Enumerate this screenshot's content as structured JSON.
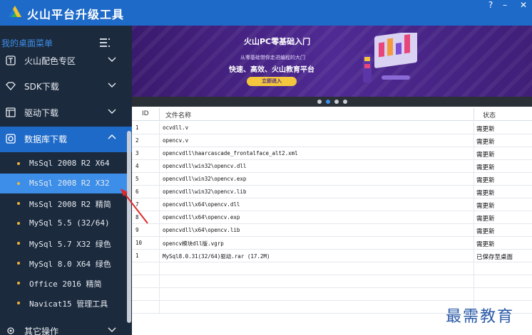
{
  "app": {
    "title": "火山平台升级工具",
    "help": "?",
    "minimize": "–",
    "close": "✕"
  },
  "sidebar": {
    "header": "我的桌面菜单",
    "categories": [
      {
        "label": "火山配色专区",
        "icon": "text-box-icon",
        "expanded": false
      },
      {
        "label": "SDK下载",
        "icon": "diamond-icon",
        "expanded": false
      },
      {
        "label": "驱动下载",
        "icon": "window-icon",
        "expanded": false
      },
      {
        "label": "数据库下载",
        "icon": "database-icon",
        "expanded": true
      },
      {
        "label": "其它操作",
        "icon": "gear-icon",
        "expanded": false
      }
    ],
    "subitems": [
      {
        "label": "MsSql 2008 R2 X64"
      },
      {
        "label": "MsSql 2008 R2 X32"
      },
      {
        "label": "MsSql 2008 R2 精简"
      },
      {
        "label": "MySql 5.5 (32/64)"
      },
      {
        "label": "MySql 5.7 X32 绿色"
      },
      {
        "label": "MySql 8.0 X64 绿色"
      },
      {
        "label": "Office 2016 精简"
      },
      {
        "label": "Navicat15 管理工具"
      }
    ],
    "selected_index": 1,
    "accent": "#1e6ac8"
  },
  "banner": {
    "title": "火山PC零基础入门",
    "subtitle": "从零基础带你走进编程的大门",
    "slogan": "快速、高效、火山教育平台",
    "button": "立即进入",
    "slides": 4,
    "active_slide": 1
  },
  "table": {
    "headers": {
      "id": "ID",
      "name": "文件名称",
      "status": "状态"
    },
    "rows": [
      {
        "id": "1",
        "name": "ocvdll.v",
        "status": "需更新"
      },
      {
        "id": "2",
        "name": "opencv.v",
        "status": "需更新"
      },
      {
        "id": "3",
        "name": "opencvdll\\haarcascade_frontalface_alt2.xml",
        "status": "需更新"
      },
      {
        "id": "4",
        "name": "opencvdll\\win32\\opencv.dll",
        "status": "需更新"
      },
      {
        "id": "5",
        "name": "opencvdll\\win32\\opencv.exp",
        "status": "需更新"
      },
      {
        "id": "6",
        "name": "opencvdll\\win32\\opencv.lib",
        "status": "需更新"
      },
      {
        "id": "7",
        "name": "opencvdll\\x64\\opencv.dll",
        "status": "需更新"
      },
      {
        "id": "8",
        "name": "opencvdll\\x64\\opencv.exp",
        "status": "需更新"
      },
      {
        "id": "9",
        "name": "opencvdll\\x64\\opencv.lib",
        "status": "需更新"
      },
      {
        "id": "10",
        "name": "opencv模块dll版.vgrp",
        "status": "需更新"
      },
      {
        "id": "1",
        "name": "MySql8.0.31(32/64)驱动.rar  (17.2M)",
        "status": "已保存至桌面"
      }
    ]
  },
  "watermark": "最需教育"
}
